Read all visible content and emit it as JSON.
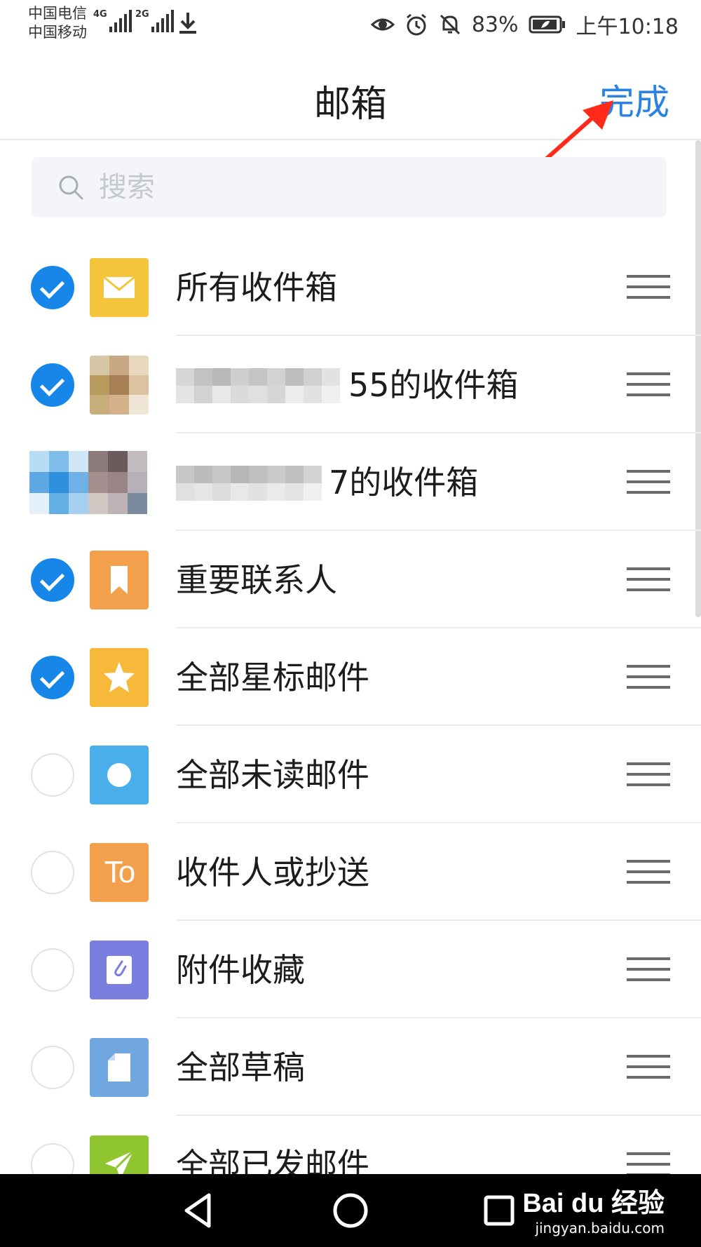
{
  "status_bar": {
    "carrier_1": "中国电信",
    "carrier_2": "中国移动",
    "net_1": "4G",
    "net_2": "2G",
    "battery": "83%",
    "time": "上午10:18"
  },
  "header": {
    "title": "邮箱",
    "done_label": "完成"
  },
  "search": {
    "placeholder": "搜索"
  },
  "mailboxes": [
    {
      "label": "所有收件箱",
      "checked": true,
      "icon": "envelope-icon",
      "color": "#f4c53a"
    },
    {
      "label": "55的收件箱",
      "checked": true,
      "icon": "account-avatar",
      "color": "#c9b48c"
    },
    {
      "label": "7的收件箱",
      "checked": true,
      "icon": "account-avatar",
      "color": "#6da6e0"
    },
    {
      "label": "重要联系人",
      "checked": true,
      "icon": "bookmark-icon",
      "color": "#f3a04c"
    },
    {
      "label": "全部星标邮件",
      "checked": true,
      "icon": "star-icon",
      "color": "#f6b93a"
    },
    {
      "label": "全部未读邮件",
      "checked": false,
      "icon": "dot-icon",
      "color": "#4aaeea"
    },
    {
      "label": "收件人或抄送",
      "checked": false,
      "icon": "to-icon",
      "icon_text": "To",
      "color": "#f3a04c"
    },
    {
      "label": "附件收藏",
      "checked": false,
      "icon": "paperclip-icon",
      "color": "#7a7fdf"
    },
    {
      "label": "全部草稿",
      "checked": false,
      "icon": "draft-icon",
      "color": "#6fa7de"
    },
    {
      "label": "全部已发邮件",
      "checked": false,
      "icon": "send-icon",
      "color": "#8fc62f"
    }
  ],
  "watermark": {
    "brand": "Bai du 经验",
    "url": "jingyan.baidu.com"
  }
}
